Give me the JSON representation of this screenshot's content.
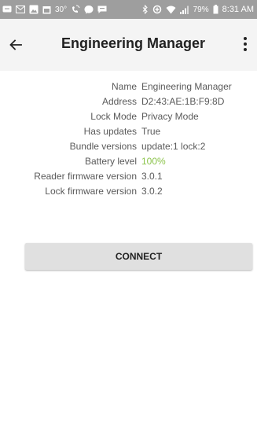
{
  "status_bar": {
    "temperature": "30°",
    "battery_percent": "79%",
    "time": "8:31 AM",
    "icons": [
      "message-icon",
      "gmail-icon",
      "gallery-icon",
      "calendar-icon",
      "temperature-icon",
      "wifi-calling-icon",
      "messenger-icon",
      "chat-icon",
      "bluetooth-icon",
      "data-saver-icon",
      "wifi-icon",
      "signal-icon",
      "battery-icon"
    ]
  },
  "app_bar": {
    "title": "Engineering Manager",
    "back_icon": "arrow-left-icon",
    "menu_icon": "more-vert-icon"
  },
  "details": {
    "rows": [
      {
        "label": "Name",
        "value": "Engineering Manager"
      },
      {
        "label": "Address",
        "value": "D2:43:AE:1B:F9:8D"
      },
      {
        "label": "Lock Mode",
        "value": "Privacy Mode"
      },
      {
        "label": "Has updates",
        "value": "True"
      },
      {
        "label": "Bundle versions",
        "value": "update:1 lock:2"
      },
      {
        "label": "Battery level",
        "value": "100%"
      },
      {
        "label": "Reader firmware version",
        "value": "3.0.1"
      },
      {
        "label": "Lock firmware version",
        "value": "3.0.2"
      }
    ],
    "highlight_color": "#8bc34a"
  },
  "connect_button": {
    "label": "CONNECT"
  }
}
